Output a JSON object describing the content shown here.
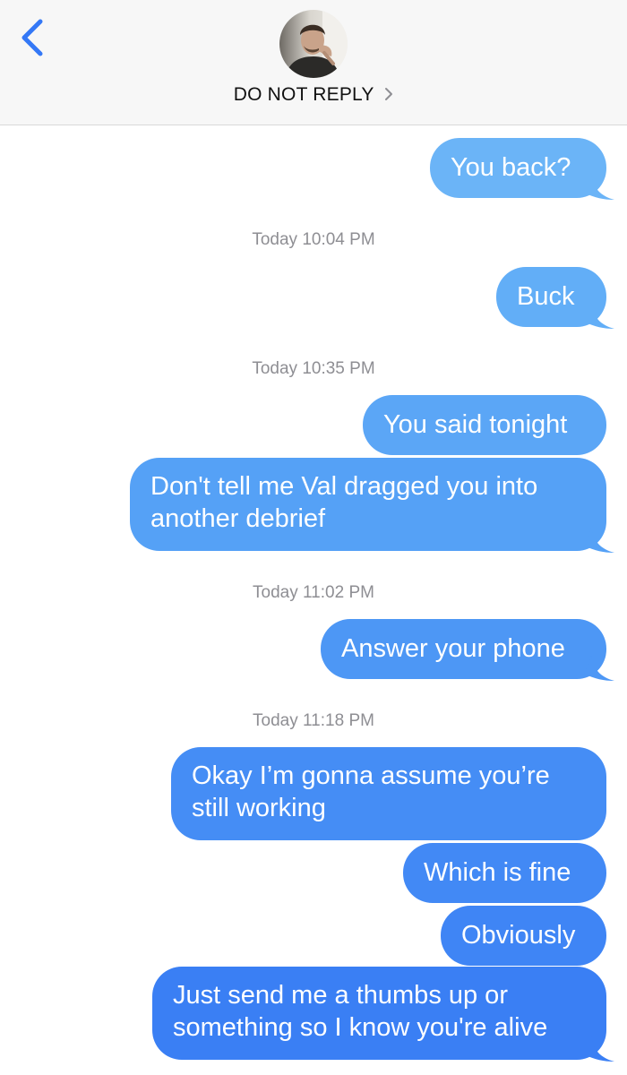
{
  "header": {
    "contact_name": "DO NOT REPLY",
    "back_icon": "chevron-left-icon",
    "chevron_icon": "chevron-right-icon",
    "accent_color": "#3478f6"
  },
  "thread": {
    "messages": [
      {
        "text": "You back?",
        "direction": "outgoing",
        "color": "#6bb4f7"
      },
      {
        "timestamp": "Today 10:04 PM"
      },
      {
        "text": "Buck",
        "direction": "outgoing",
        "color": "#62aef7"
      },
      {
        "timestamp": "Today 10:35 PM"
      },
      {
        "text": "You said tonight",
        "direction": "outgoing",
        "color": "#5ba6f6"
      },
      {
        "text": "Don't tell me Val dragged you into another debrief",
        "direction": "outgoing",
        "color": "#55a1f6"
      },
      {
        "timestamp": "Today 11:02 PM"
      },
      {
        "text": "Answer your phone",
        "direction": "outgoing",
        "color": "#4d97f5"
      },
      {
        "timestamp": "Today 11:18 PM"
      },
      {
        "text": "Okay I’m gonna assume you’re still working",
        "direction": "outgoing",
        "color": "#458df5"
      },
      {
        "text": "Which is fine",
        "direction": "outgoing",
        "color": "#4289f5"
      },
      {
        "text": "Obviously",
        "direction": "outgoing",
        "color": "#3f85f5"
      },
      {
        "text": "Just send me a thumbs up or something so I know you're alive",
        "direction": "outgoing",
        "color": "#3a7ff4"
      }
    ]
  }
}
